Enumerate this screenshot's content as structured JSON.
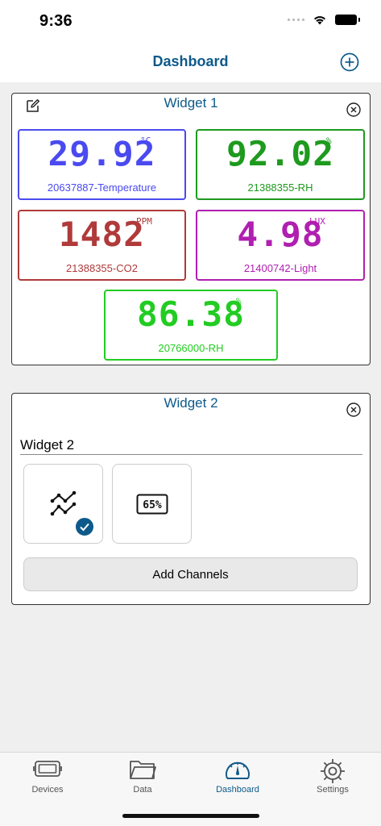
{
  "status_bar": {
    "time": "9:36"
  },
  "nav": {
    "title": "Dashboard"
  },
  "widget1": {
    "title": "Widget 1",
    "tiles": [
      {
        "value": "29.92",
        "unit": "°C",
        "label": "20637887-Temperature",
        "color": "#4a4af0"
      },
      {
        "value": "92.02",
        "unit": "%",
        "label": "21388355-RH",
        "color": "#1e9a1e"
      },
      {
        "value": "1482",
        "unit": "PPM",
        "label": "21388355-CO2",
        "color": "#b03a3a"
      },
      {
        "value": "4.98",
        "unit": "LUX",
        "label": "21400742-Light",
        "color": "#b01fb0"
      },
      {
        "value": "86.38",
        "unit": "%",
        "label": "20766000-RH",
        "color": "#22cc22"
      }
    ]
  },
  "widget2": {
    "title": "Widget 2",
    "name_value": "Widget 2",
    "widget_types": [
      {
        "icon": "chart-line-icon",
        "selected": true
      },
      {
        "icon": "digital-display-icon",
        "display_text": "65%",
        "selected": false
      }
    ],
    "add_channels_label": "Add Channels"
  },
  "tabs": [
    {
      "label": "Devices",
      "icon": "device-icon",
      "active": false
    },
    {
      "label": "Data",
      "icon": "folder-icon",
      "active": false
    },
    {
      "label": "Dashboard",
      "icon": "gauge-icon",
      "active": true
    },
    {
      "label": "Settings",
      "icon": "gear-icon",
      "active": false
    }
  ],
  "colors": {
    "accent": "#0d5a8a"
  }
}
